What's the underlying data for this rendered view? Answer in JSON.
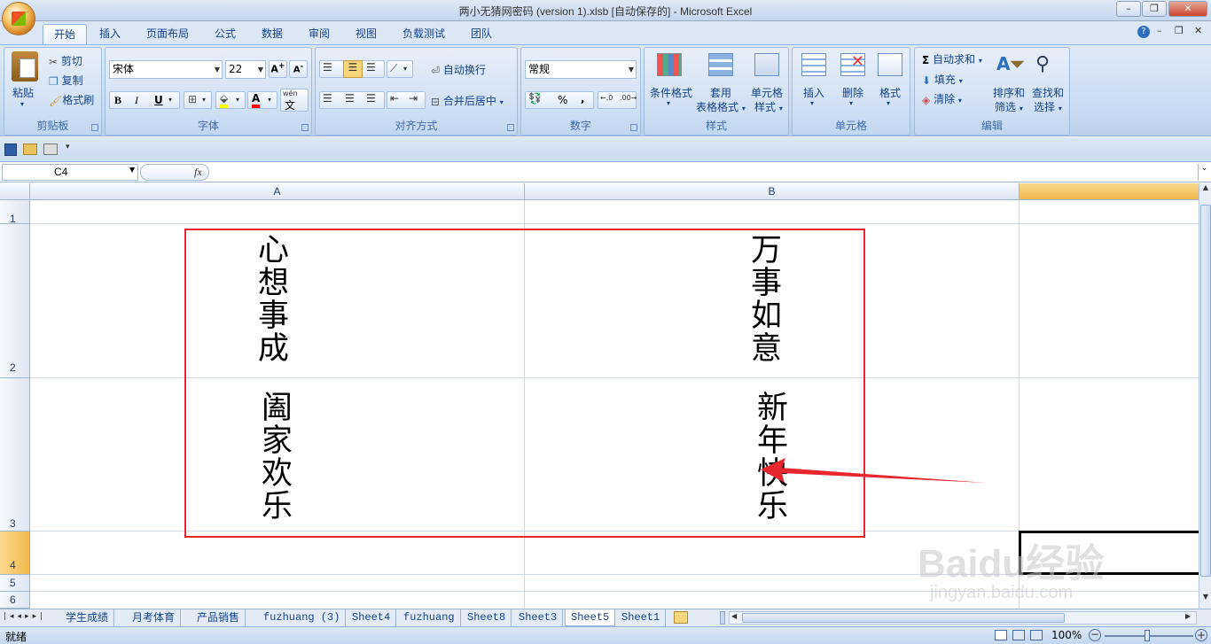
{
  "window": {
    "title": "两小无猜网密码 (version 1).xlsb [自动保存的] - Microsoft Excel",
    "minimize": "–",
    "restore": "❐",
    "close": "✕"
  },
  "ribbon": {
    "tabs": [
      "开始",
      "插入",
      "页面布局",
      "公式",
      "数据",
      "审阅",
      "视图",
      "负载测试",
      "团队"
    ],
    "clipboard": {
      "label": "剪贴板",
      "paste": "粘贴",
      "cut": "剪切",
      "copy": "复制",
      "format_painter": "格式刷"
    },
    "font": {
      "label": "字体",
      "name": "宋体",
      "size": "22",
      "bold": "B",
      "italic": "I",
      "underline": "U",
      "wen": "wén"
    },
    "alignment": {
      "label": "对齐方式",
      "wrap": "自动换行",
      "merge": "合并后居中"
    },
    "number": {
      "label": "数字",
      "format": "常规",
      "percent": "%",
      "comma": ","
    },
    "styles": {
      "label": "样式",
      "conditional": "条件格式",
      "table_line1": "套用",
      "table_line2": "表格格式",
      "cell_line1": "单元格",
      "cell_line2": "样式"
    },
    "cells": {
      "label": "单元格",
      "insert": "插入",
      "delete": "删除",
      "format": "格式"
    },
    "editing": {
      "label": "编辑",
      "autosum": "自动求和",
      "fill": "填充",
      "clear": "清除",
      "sort_line1": "排序和",
      "sort_line2": "筛选",
      "find_line1": "查找和",
      "find_line2": "选择"
    }
  },
  "formula_bar": {
    "name_box": "C4",
    "fx": "fx",
    "value": ""
  },
  "grid": {
    "columns": [
      "A",
      "B"
    ],
    "rows": [
      "1",
      "2",
      "3",
      "4",
      "5",
      "6"
    ],
    "cells": {
      "A2": "心想事成",
      "B2": "万事如意",
      "A3": "阖家欢乐",
      "B3": "新年快乐"
    }
  },
  "sheet_tabs": [
    "学生成绩",
    "月考体育",
    "产品销售",
    "fuzhuang (3)",
    "Sheet4",
    "fuzhuang",
    "Sheet8",
    "Sheet3",
    "Sheet5",
    "Sheet1"
  ],
  "active_sheet": "Sheet5",
  "status": {
    "ready": "就绪",
    "zoom": "100%"
  },
  "watermark": {
    "brand": "Baidu经验",
    "url": "jingyan.baidu.com"
  },
  "colors": {
    "annotation": "#e8262d",
    "ribbon_text": "#15428b"
  }
}
